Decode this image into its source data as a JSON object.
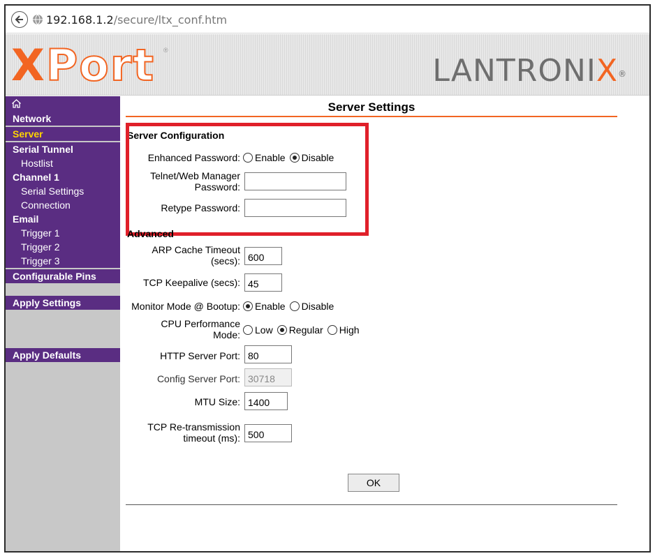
{
  "browser": {
    "url_host": "192.168.1.2",
    "url_path": "/secure/ltx_conf.htm"
  },
  "banner": {
    "logo_left_x": "X",
    "logo_left_rest": "Port",
    "logo_left_reg": "®",
    "logo_right_main": "LANTRONI",
    "logo_right_x": "X",
    "logo_right_reg": "®"
  },
  "sidebar": {
    "items": [
      {
        "label": "Network"
      },
      {
        "label": "Server"
      },
      {
        "label": "Serial Tunnel"
      },
      {
        "label": "Hostlist"
      },
      {
        "label": "Channel 1"
      },
      {
        "label": "Serial Settings"
      },
      {
        "label": "Connection"
      },
      {
        "label": "Email"
      },
      {
        "label": "Trigger 1"
      },
      {
        "label": "Trigger 2"
      },
      {
        "label": "Trigger 3"
      },
      {
        "label": "Configurable Pins"
      },
      {
        "label": "Apply Settings"
      },
      {
        "label": "Apply Defaults"
      }
    ]
  },
  "main": {
    "title": "Server Settings",
    "server_config": {
      "heading": "Server Configuration",
      "enhanced_password_label": "Enhanced Password:",
      "enhanced_password_options": [
        "Enable",
        "Disable"
      ],
      "enhanced_password_selected": "Disable",
      "telnet_password_label_1": "Telnet/Web Manager",
      "telnet_password_label_2": "Password:",
      "telnet_password_value": "",
      "retype_password_label": "Retype Password:",
      "retype_password_value": ""
    },
    "advanced": {
      "heading": "Advanced",
      "arp_label_1": "ARP Cache Timeout",
      "arp_label_2": "(secs):",
      "arp_value": "600",
      "tcp_keepalive_label": "TCP Keepalive (secs):",
      "tcp_keepalive_value": "45",
      "monitor_mode_label": "Monitor Mode @ Bootup:",
      "monitor_mode_options": [
        "Enable",
        "Disable"
      ],
      "monitor_mode_selected": "Enable",
      "cpu_label_1": "CPU Performance",
      "cpu_label_2": "Mode:",
      "cpu_options": [
        "Low",
        "Regular",
        "High"
      ],
      "cpu_selected": "Regular",
      "http_port_label": "HTTP Server Port:",
      "http_port_value": "80",
      "config_port_label": "Config Server Port:",
      "config_port_value": "30718",
      "mtu_label": "MTU Size:",
      "mtu_value": "1400",
      "tcp_retrans_label_1": "TCP Re-transmission",
      "tcp_retrans_label_2": "timeout (ms):",
      "tcp_retrans_value": "500"
    },
    "ok_label": "OK"
  },
  "colors": {
    "sidebar_purple": "#5a2d82",
    "active_yellow": "#ffd400",
    "accent_orange": "#f26522",
    "highlight_red": "#e0202a"
  }
}
